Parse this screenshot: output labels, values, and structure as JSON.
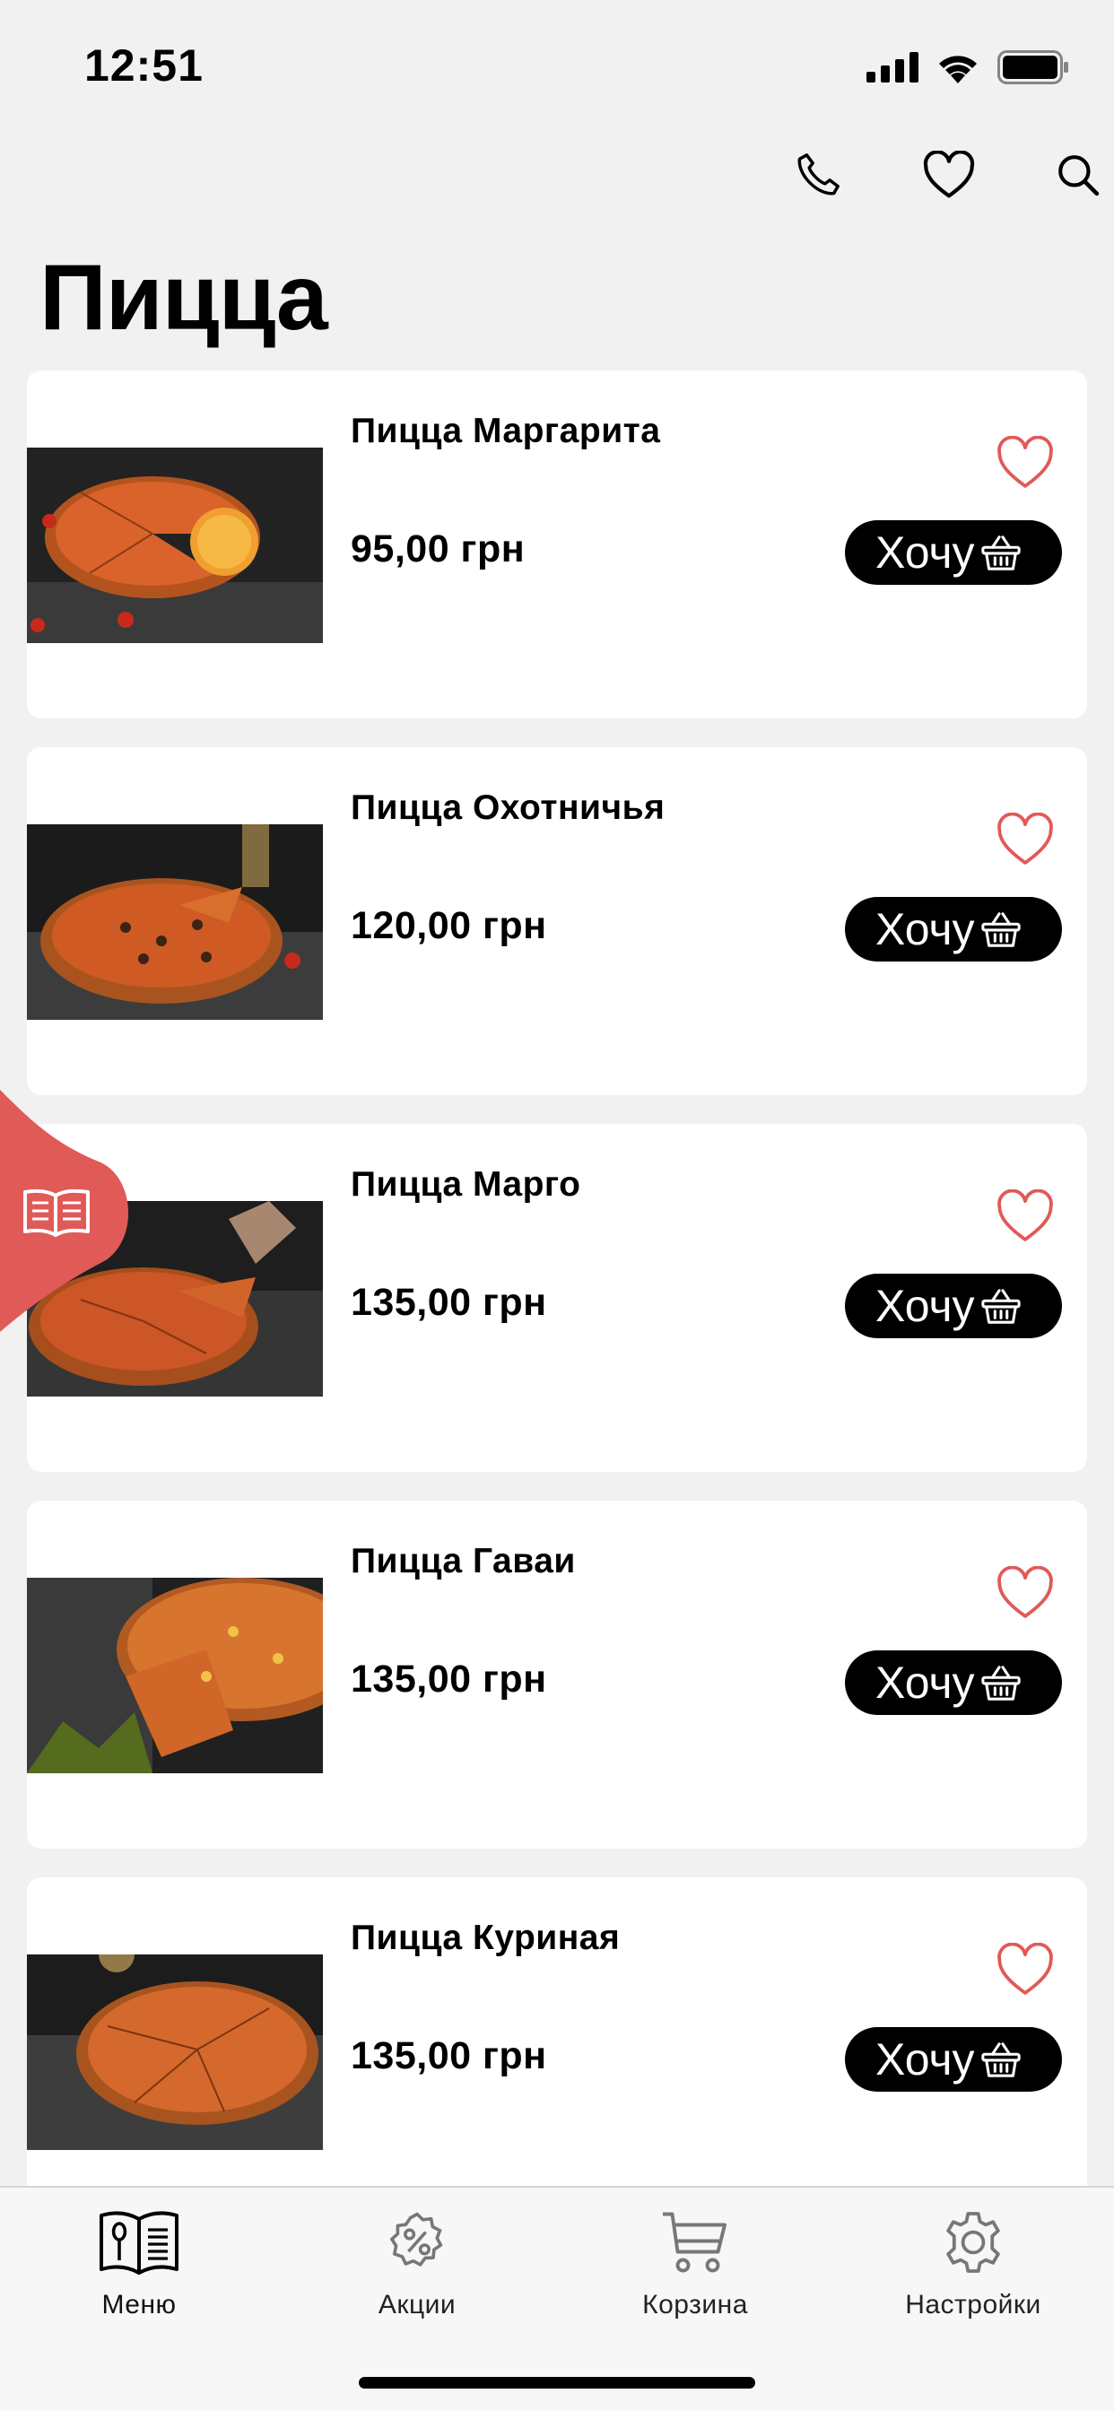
{
  "status_bar": {
    "time": "12:51"
  },
  "header": {
    "title": "Пицца"
  },
  "products": [
    {
      "name": "Пицца Маргарита",
      "price": "95,00 грн",
      "button_label": "Хочу"
    },
    {
      "name": "Пицца Охотничья",
      "price": "120,00 грн",
      "button_label": "Хочу"
    },
    {
      "name": "Пицца Марго",
      "price": "135,00 грн",
      "button_label": "Хочу"
    },
    {
      "name": "Пицца Гаваи",
      "price": "135,00 грн",
      "button_label": "Хочу"
    },
    {
      "name": "Пицца Куриная",
      "price": "135,00 грн",
      "button_label": "Хочу"
    }
  ],
  "tabbar": {
    "items": [
      {
        "label": "Меню",
        "icon": "menu-book-icon",
        "active": true
      },
      {
        "label": "Акции",
        "icon": "discount-icon",
        "active": false
      },
      {
        "label": "Корзина",
        "icon": "cart-icon",
        "active": false
      },
      {
        "label": "Настройки",
        "icon": "gear-icon",
        "active": false
      }
    ]
  },
  "colors": {
    "accent": "#e05a57",
    "background": "#f1f1f1",
    "button": "#000000"
  }
}
